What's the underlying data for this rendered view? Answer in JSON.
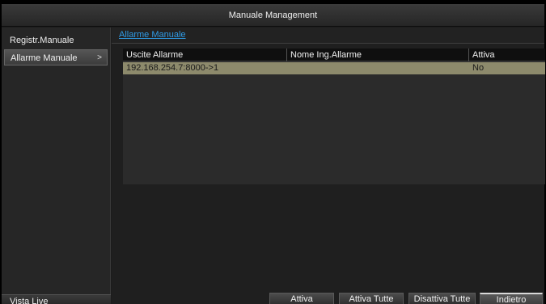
{
  "window": {
    "title": "Manuale Management"
  },
  "sidebar": {
    "items": [
      {
        "label": "Registr.Manuale",
        "active": false
      },
      {
        "label": "Allarme Manuale",
        "active": true,
        "chevron": ">"
      }
    ],
    "live_view_label": "Vista Live"
  },
  "main": {
    "tab": "Allarme Manuale",
    "table": {
      "columns": [
        "Uscite Allarme",
        "Nome Ing.Allarme",
        "Attiva"
      ],
      "rows": [
        {
          "output": "192.168.254.7:8000->1",
          "name": "",
          "active": "No"
        }
      ]
    },
    "buttons": {
      "activate": "Attiva",
      "activate_all": "Attiva Tutte",
      "deactivate_all": "Disattiva Tutte",
      "back": "Indietro"
    }
  },
  "colors": {
    "accent_link": "#2f9be6",
    "selected_row": "#8d8a6c",
    "background": "#1f1f1f"
  }
}
